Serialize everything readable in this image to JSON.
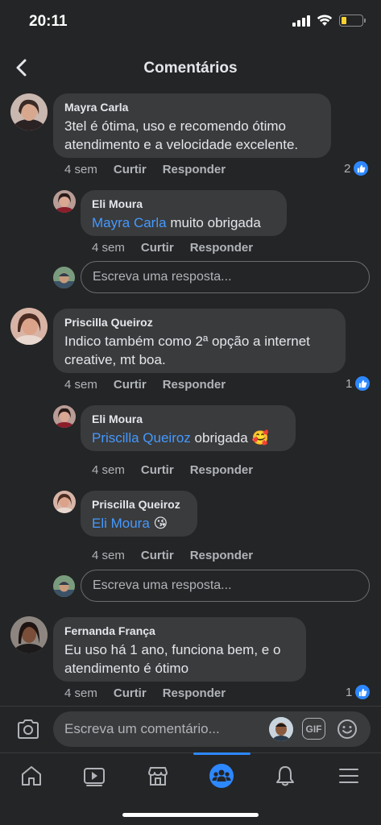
{
  "status_bar": {
    "time": "20:11",
    "battery_level": 0.25,
    "battery_color": "#f7d230"
  },
  "header": {
    "title": "Comentários",
    "back_icon": "chevron-left-icon"
  },
  "comments": [
    {
      "author": "Mayra Carla",
      "text_line1": "3tel é ótima, uso e recomendo ótimo",
      "text_line2": "atendimento e a velocidade excelente.",
      "time": "4 sem",
      "like": "Curtir",
      "reply": "Responder",
      "likes": "2",
      "replies": [
        {
          "author": "Eli Moura",
          "mention": "Mayra Carla",
          "text": " muito obrigada",
          "emoji": "",
          "time": "4 sem",
          "like": "Curtir",
          "reply": "Responder"
        }
      ],
      "reply_placeholder": "Escreva uma resposta..."
    },
    {
      "author": "Priscilla Queiroz",
      "text_line1": "Indico também como 2ª opção a internet",
      "text_line2": "creative, mt boa.",
      "time": "4 sem",
      "like": "Curtir",
      "reply": "Responder",
      "likes": "1",
      "replies": [
        {
          "author": "Eli Moura",
          "mention": "Priscilla Queiroz",
          "text": " obrigada ",
          "emoji": "🥰",
          "time": "4 sem",
          "like": "Curtir",
          "reply": "Responder"
        },
        {
          "author": "Priscilla Queiroz",
          "mention": "Eli Moura",
          "text": " ",
          "emoji": "😘",
          "time": "4 sem",
          "like": "Curtir",
          "reply": "Responder"
        }
      ],
      "reply_placeholder": "Escreva uma resposta..."
    },
    {
      "author": "Fernanda França",
      "text_line1": "Eu uso há 1 ano, funciona bem, e o",
      "text_line2": "atendimento é ótimo",
      "time": "4 sem",
      "like": "Curtir",
      "reply": "Responder",
      "likes": "1"
    }
  ],
  "composer": {
    "placeholder": "Escreva um comentário...",
    "gif_label": "GIF"
  },
  "tabbar": {
    "tabs": [
      "home-icon",
      "watch-icon",
      "marketplace-icon",
      "groups-icon",
      "notifications-icon",
      "menu-icon"
    ],
    "active": "groups-icon",
    "accent": "#2d88ff"
  }
}
